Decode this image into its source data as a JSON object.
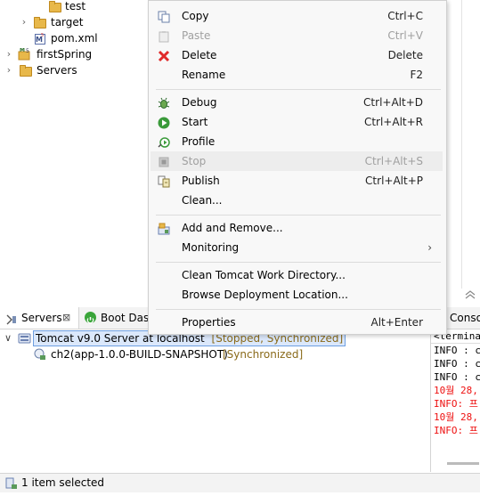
{
  "project_tree": {
    "items": [
      {
        "label": "test",
        "icon": "folder-icon"
      },
      {
        "label": "target",
        "icon": "folder-icon"
      },
      {
        "label": "pom.xml",
        "icon": "maven-file-icon"
      },
      {
        "label": "firstSpring",
        "icon": "project-icon"
      },
      {
        "label": "Servers",
        "icon": "folder-icon"
      }
    ]
  },
  "bottom_panel": {
    "tabs": [
      {
        "label": "Servers",
        "close": "⊠"
      },
      {
        "label": "Boot Dash"
      }
    ],
    "server": {
      "name": "Tomcat v9.0 Server at localhost",
      "state": "[Stopped, Synchronized]",
      "module": "ch2(app-1.0.0-BUILD-SNAPSHOT)",
      "module_state": "[Synchronized]"
    }
  },
  "console": {
    "tab_label": "Conso",
    "header": "<terminate",
    "lines": [
      {
        "text": "INFO : c",
        "color": "#000000"
      },
      {
        "text": "INFO : c",
        "color": "#000000"
      },
      {
        "text": "INFO : c",
        "color": "#000000"
      },
      {
        "text": "10월 28,",
        "color": "#e11111"
      },
      {
        "text": "INFO: 프",
        "color": "#e11111"
      },
      {
        "text": "10월 28,",
        "color": "#e11111"
      },
      {
        "text": "INFO: 프",
        "color": "#e11111"
      }
    ]
  },
  "context_menu": {
    "items": [
      {
        "label": "Copy",
        "shortcut": "Ctrl+C",
        "icon": "copy-icon"
      },
      {
        "label": "Paste",
        "shortcut": "Ctrl+V",
        "icon": "paste-icon",
        "disabled": true
      },
      {
        "label": "Delete",
        "shortcut": "Delete",
        "icon": "delete-icon"
      },
      {
        "label": "Rename",
        "shortcut": "F2"
      },
      {
        "label": "Debug",
        "shortcut": "Ctrl+Alt+D",
        "icon": "debug-icon"
      },
      {
        "label": "Start",
        "shortcut": "Ctrl+Alt+R",
        "icon": "start-icon"
      },
      {
        "label": "Profile",
        "shortcut": "",
        "icon": "profile-icon"
      },
      {
        "label": "Stop",
        "shortcut": "Ctrl+Alt+S",
        "icon": "stop-icon",
        "disabled": true
      },
      {
        "label": "Publish",
        "shortcut": "Ctrl+Alt+P",
        "icon": "publish-icon"
      },
      {
        "label": "Clean...",
        "shortcut": ""
      },
      {
        "label": "Add and Remove...",
        "shortcut": "",
        "icon": "add-remove-icon"
      },
      {
        "label": "Monitoring",
        "shortcut": "",
        "submenu": "›"
      },
      {
        "label": "Clean Tomcat Work Directory...",
        "shortcut": ""
      },
      {
        "label": "Browse Deployment Location...",
        "shortcut": ""
      },
      {
        "label": "Properties",
        "shortcut": "Alt+Enter"
      }
    ]
  },
  "status_bar": {
    "text": "1 item selected"
  }
}
